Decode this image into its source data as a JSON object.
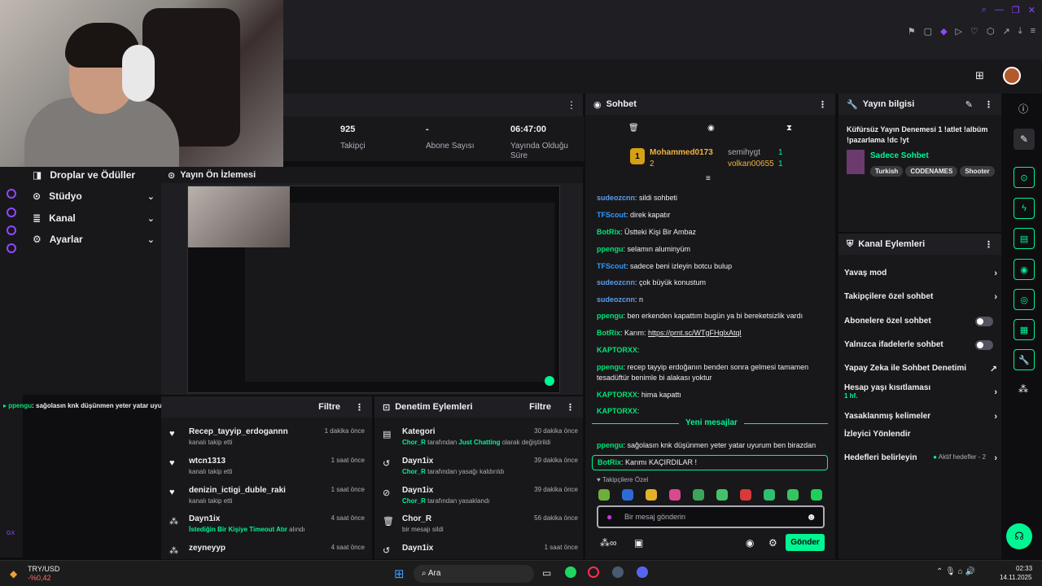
{
  "stats": {
    "followers": {
      "value": "925",
      "label": "Takipçi"
    },
    "subs": {
      "value": "-",
      "label": "Abone Sayısı"
    },
    "uptime": {
      "value": "06:47:00",
      "label": "Yayında Olduğu Süre"
    }
  },
  "left_menu": {
    "drops": "Droplar ve Ödüller",
    "studio": "Stüdyo",
    "channel": "Kanal",
    "settings": "Ayarlar"
  },
  "preview": {
    "title": "Yayın Ön İzlemesi"
  },
  "overlay_chat": {
    "user": "ppengu",
    "text": ": sağolasın knk düşünmen yeter yatar uyurum ben birazdan"
  },
  "activity": {
    "filter": "Filtre",
    "items": [
      {
        "name": "Recep_tayyip_erdogannn",
        "sub": "kanalı takip etti",
        "time": "1 dakika önce"
      },
      {
        "name": "wtcn1313",
        "sub": "kanalı takip etti",
        "time": "1 saat önce"
      },
      {
        "name": "denizin_ictigi_duble_raki",
        "sub": "kanalı takip etti",
        "time": "1 saat önce"
      },
      {
        "name": "Dayn1ix",
        "sub_hl": "İstediğin Bir Kişiye Timeout Atır",
        "sub": " alındı",
        "time": "4 saat önce"
      },
      {
        "name": "zeyneyyp",
        "time": "4 saat önce"
      }
    ]
  },
  "moderation": {
    "title": "Denetim Eylemleri",
    "filter": "Filtre",
    "items": [
      {
        "name": "Kategori",
        "actor": "Chor_R",
        "mid": " tarafından ",
        "hl": "Just Chatting",
        "end": " olarak değiştirildi",
        "time": "30 dakika önce"
      },
      {
        "name": "Dayn1ix",
        "actor": "Chor_R",
        "end": " tarafından yasağı kaldırıldı",
        "time": "39 dakika önce"
      },
      {
        "name": "Dayn1ix",
        "actor": "Chor_R",
        "end": " tarafından yasaklandı",
        "time": "39 dakika önce"
      },
      {
        "name": "Chor_R",
        "end": "bir mesajı sildi",
        "time": "56 dakika önce"
      },
      {
        "name": "Dayn1ix",
        "time": "1 saat önce"
      }
    ]
  },
  "chat": {
    "title": "Sohbet",
    "leaders": {
      "first": "Mohammed0173",
      "first_count": "2",
      "second": "semihygt",
      "second_count": "1",
      "third": "volkan00655",
      "third_count": "1",
      "rank": "1"
    },
    "messages": [
      {
        "user": "sudeozcnn",
        "text": ": sildi sohbeti"
      },
      {
        "user": "TFScout",
        "text": ": direk kapatır"
      },
      {
        "user": "BotRix",
        "text": ": Üstteki Kişi Bir Ambaz"
      },
      {
        "user": "ppengu",
        "text": ": selamın aluminyüm"
      },
      {
        "user": "TFScout",
        "text": ": sadece beni izleyin botcu bulup"
      },
      {
        "user": "sudeozcnn",
        "text": ": çok büyük konustum"
      },
      {
        "user": "sudeozcnn",
        "text": ": n"
      },
      {
        "user": "ppengu",
        "text": ": ben erkenden kapattım bugün ya bi bereketsizlik vardı"
      },
      {
        "user": "BotRix",
        "text": ": Karım: ",
        "link": "https://prnt.sc/WTgFHglxAtql"
      },
      {
        "user": "KAPTORXX",
        "text": ":"
      },
      {
        "user": "ppengu",
        "text": ": recep tayyip erdoğanın benden sonra gelmesi tamamen tesadüftür benimle bi alakası yoktur"
      },
      {
        "user": "KAPTORXX",
        "text": ": hima kapattı"
      },
      {
        "user": "KAPTORXX",
        "text": ":"
      },
      {
        "user": "ppengu",
        "text": ": sağolasın knk düşünmen yeter yatar uyurum ben birazdan"
      },
      {
        "user": "BotRix",
        "text": ": Karımı KAÇIRDILAR !"
      }
    ],
    "new_messages": "Yeni mesajlar",
    "emote_label": "Takipçilere Özel",
    "placeholder": "Bir mesaj gönderin",
    "send": "Gönder"
  },
  "stream_info": {
    "title": "Yayın bilgisi",
    "stream_title": "Küfürsüz Yayın Denemesi 1 !atlet !albüm !pazarlama !dc !yt",
    "category": "Sadece Sohbet",
    "tags": [
      "Turkish",
      "CODENAMES",
      "Shooter"
    ]
  },
  "channel_actions": {
    "title": "Kanal Eylemleri",
    "items": {
      "slow": "Yavaş mod",
      "followers": "Takipçilere özel sohbet",
      "subs": "Abonelere özel sohbet",
      "emotes": "Yalnızca ifadelerle sohbet",
      "ai": "Yapay Zeka ile Sohbet Denetimi",
      "age": "Hesap yaşı kısıtlaması",
      "age_val": "1 hf.",
      "words": "Yasaklanmış kelimeler",
      "redirect": "İzleyici Yönlendir",
      "goals": "Hedefleri belirleyin",
      "goals_status": "Aktif hedefler - 2"
    }
  },
  "taskbar": {
    "ticker": "TRY/USD",
    "ticker_change": "-%0,42",
    "search": "Ara",
    "time": "02:33",
    "date": "14.11.2025"
  },
  "misc": {
    "gx": "GX"
  },
  "colors": {
    "accent": "#00f593",
    "bg": "#18181b",
    "purple": "#9147ff"
  }
}
